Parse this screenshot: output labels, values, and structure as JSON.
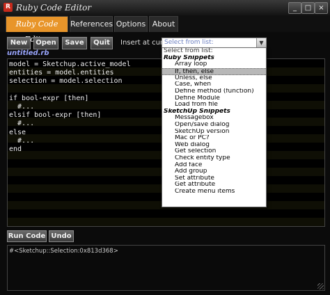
{
  "window": {
    "title": "Ruby Code Editor",
    "app_icon": "ruby-icon",
    "controls": [
      "_",
      "□",
      "×"
    ]
  },
  "tabs": [
    {
      "label": "Ruby Code Editor",
      "active": true
    },
    {
      "label": "References",
      "active": false
    },
    {
      "label": "Options",
      "active": false
    },
    {
      "label": "About",
      "active": false
    }
  ],
  "toolbar": {
    "new_label": "New",
    "open_label": "Open",
    "save_label": "Save",
    "quit_label": "Quit",
    "insert_label": "Insert at cursor:"
  },
  "snippet_select": {
    "selected_value": "Select from list:",
    "options": [
      {
        "label": "Select from list:",
        "kind": "placeholder"
      },
      {
        "label": "Ruby Snippets",
        "kind": "header"
      },
      {
        "label": "Array loop",
        "kind": "item"
      },
      {
        "label": "If, then, else",
        "kind": "item",
        "selected": true
      },
      {
        "label": "Unless, else",
        "kind": "item"
      },
      {
        "label": "Case, when",
        "kind": "item"
      },
      {
        "label": "Define method (function)",
        "kind": "item"
      },
      {
        "label": "Define Module",
        "kind": "item"
      },
      {
        "label": "Load from file",
        "kind": "item"
      },
      {
        "label": "SketchUp Snippets",
        "kind": "header"
      },
      {
        "label": "Messagebox",
        "kind": "item"
      },
      {
        "label": "Open/save dialog",
        "kind": "item"
      },
      {
        "label": "SketchUp version",
        "kind": "item"
      },
      {
        "label": "Mac or PC?",
        "kind": "item"
      },
      {
        "label": "Web dialog",
        "kind": "item"
      },
      {
        "label": "Get selection",
        "kind": "item"
      },
      {
        "label": "Check entity type",
        "kind": "item"
      },
      {
        "label": "Add face",
        "kind": "item"
      },
      {
        "label": "Add group",
        "kind": "item"
      },
      {
        "label": "Set attribute",
        "kind": "item"
      },
      {
        "label": "Get attribute",
        "kind": "item"
      },
      {
        "label": "Create menu items",
        "kind": "item"
      }
    ]
  },
  "editor": {
    "filename": "untitled.rb",
    "code": "model = Sketchup.active_model\nentities = model.entities\nselection = model.selection\n\nif bool-expr [then]\n  #...\nelsif bool-expr [then]\n  #...\nelse\n  #...\nend"
  },
  "actions": {
    "run_label": "Run Code",
    "undo_label": "Undo"
  },
  "output": {
    "text": "#<Sketchup::Selection:0x813d368>"
  },
  "colors": {
    "active_tab": "#e8952a",
    "filename": "#9aa6ff",
    "background": "#0b0b0b"
  }
}
